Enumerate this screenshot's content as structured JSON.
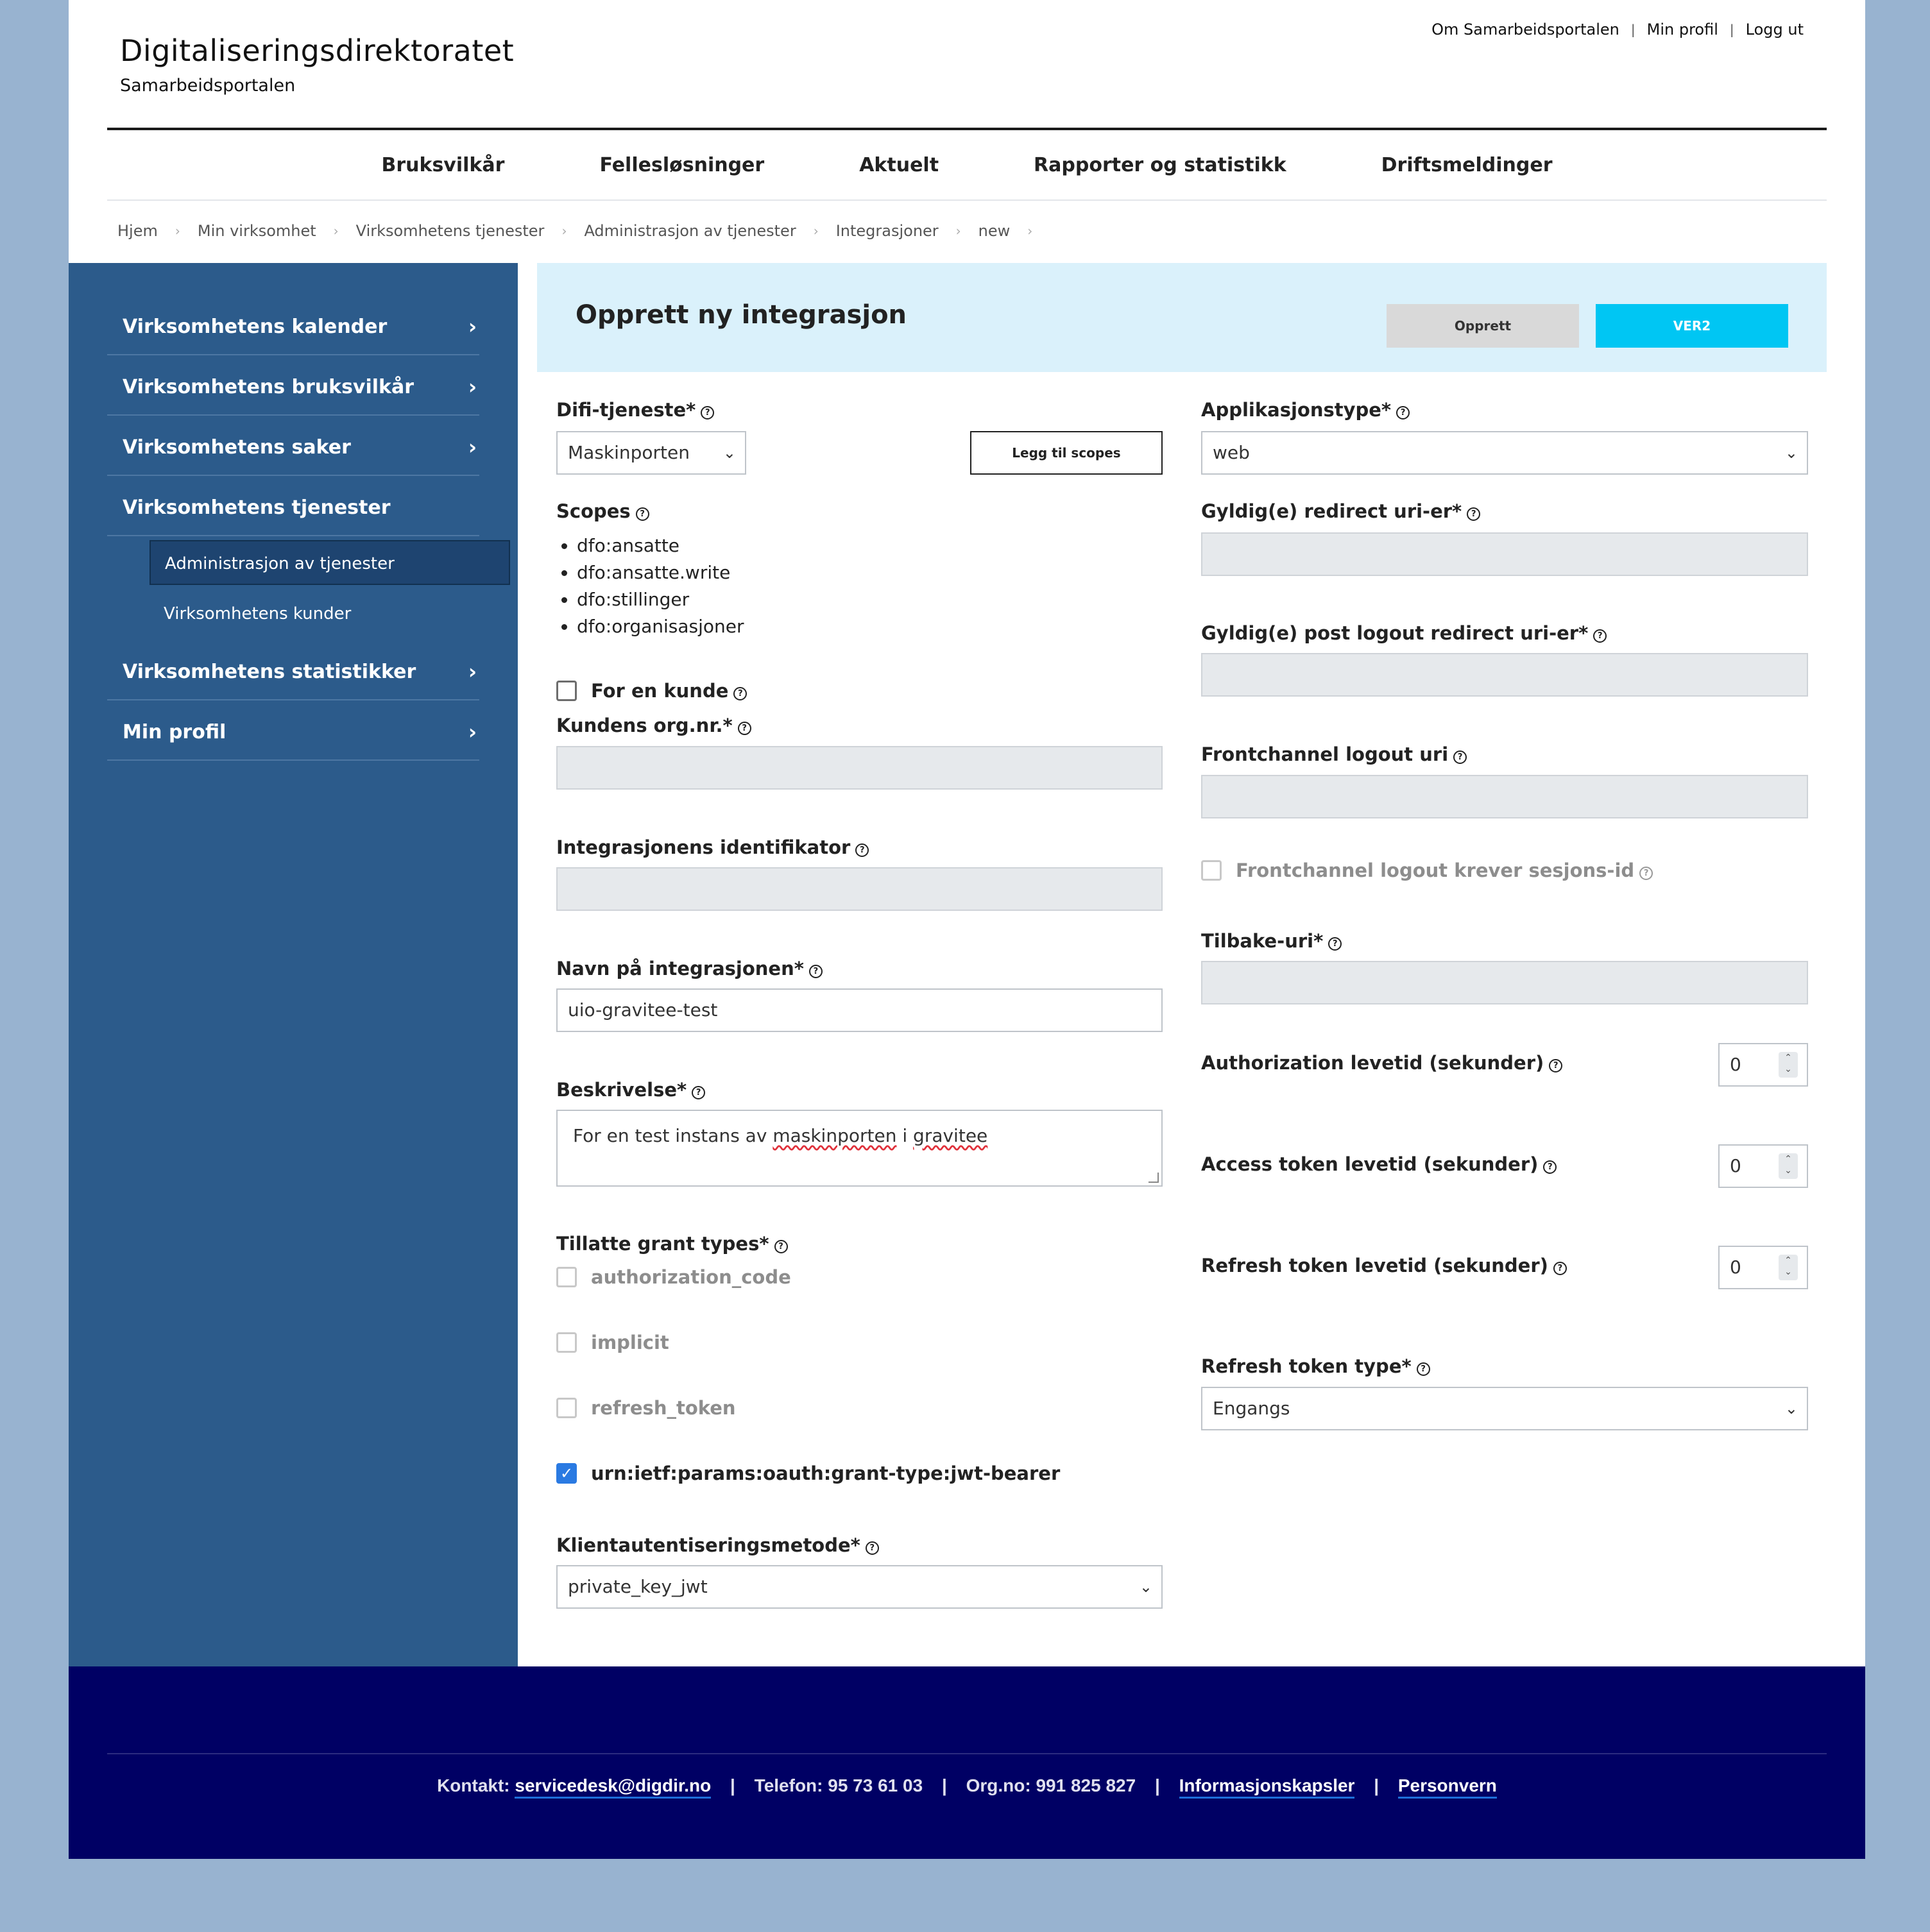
{
  "header": {
    "brand_title": "Digitaliseringsdirektoratet",
    "brand_sub": "Samarbeidsportalen",
    "top_links": [
      "Om Samarbeidsportalen",
      "Min profil",
      "Logg ut"
    ],
    "link_separator": "|"
  },
  "main_nav": [
    "Bruksvilkår",
    "Fellesløsninger",
    "Aktuelt",
    "Rapporter og statistikk",
    "Driftsmeldinger"
  ],
  "breadcrumb": [
    "Hjem",
    "Min virksomhet",
    "Virksomhetens tjenester",
    "Administrasjon av tjenester",
    "Integrasjoner",
    "new"
  ],
  "breadcrumb_sep": "›",
  "sidebar": {
    "items": [
      {
        "label": "Virksomhetens kalender",
        "arrow": "›"
      },
      {
        "label": "Virksomhetens bruksvilkår",
        "arrow": "›"
      },
      {
        "label": "Virksomhetens saker",
        "arrow": "›"
      },
      {
        "label": "Virksomhetens tjenester",
        "arrow": ""
      },
      {
        "label": "Virksomhetens statistikker",
        "arrow": "›"
      },
      {
        "label": "Min profil",
        "arrow": "›"
      }
    ],
    "sub_items": [
      "Administrasjon av tjenester",
      "Virksomhetens kunder"
    ]
  },
  "panel": {
    "title": "Opprett ny integrasjon",
    "btn_opprett": "Opprett",
    "btn_ver2": "VER2"
  },
  "form_left": {
    "difi_label": "Difi-tjeneste*",
    "difi_value": "Maskinporten",
    "add_scopes_button": "Legg til scopes",
    "scopes_label": "Scopes",
    "scopes": [
      "dfo:ansatte",
      "dfo:ansatte.write",
      "dfo:stillinger",
      "dfo:organisasjoner"
    ],
    "for_kunde_label": "For en kunde",
    "kunde_org_label": "Kundens org.nr.*",
    "kunde_org_value": "",
    "identifikator_label": "Integrasjonens identifikator",
    "identifikator_value": "",
    "navn_label": "Navn på integrasjonen*",
    "navn_value": "uio-gravitee-test",
    "beskrivelse_label": "Beskrivelse*",
    "beskrivelse_parts": [
      "For en test instans av ",
      "maskinporten",
      " i ",
      "gravitee"
    ],
    "grant_types_label": "Tillatte grant types*",
    "grant_types": [
      {
        "label": "authorization_code",
        "checked": false,
        "enabled": false
      },
      {
        "label": "implicit",
        "checked": false,
        "enabled": false
      },
      {
        "label": "refresh_token",
        "checked": false,
        "enabled": false
      },
      {
        "label": "urn:ietf:params:oauth:grant-type:jwt-bearer",
        "checked": true,
        "enabled": true
      }
    ],
    "klient_label": "Klientautentiseringsmetode*",
    "klient_value": "private_key_jwt"
  },
  "form_right": {
    "apptype_label": "Applikasjonstype*",
    "apptype_value": "web",
    "redirect_label": "Gyldig(e) redirect uri-er*",
    "post_logout_label": "Gyldig(e) post logout redirect uri-er*",
    "frontchannel_label": "Frontchannel logout uri",
    "frontchannel_sesjon_label": "Frontchannel logout krever sesjons-id",
    "tilbake_label": "Tilbake-uri*",
    "auth_levetid_label": "Authorization levetid (sekunder)",
    "auth_levetid_value": "0",
    "access_levetid_label": "Access token levetid (sekunder)",
    "access_levetid_value": "0",
    "refresh_levetid_label": "Refresh token levetid (sekunder)",
    "refresh_levetid_value": "0",
    "refresh_type_label": "Refresh token type*",
    "refresh_type_value": "Engangs"
  },
  "footer": {
    "kontakt_label": "Kontakt:",
    "kontakt_email": "servicedesk@digdir.no",
    "telefon": "Telefon: 95 73 61 03",
    "orgno": "Org.no: 991 825 827",
    "informasjonskapsler": "Informasjonskapsler",
    "personvern": "Personvern",
    "separator": "|"
  },
  "colors": {
    "page_bg": "#98b3d0",
    "sidebar_bg": "#2c5b8b",
    "panel_head_bg": "#daf1fb",
    "ver2_button": "#00c6f3",
    "checkbox_checked": "#2a7ae2",
    "footer_bg": "#000064"
  },
  "icons": {
    "help": "question-circle-icon",
    "dropdown": "chevron-down-icon",
    "spinner": "up-down-spinner-icon",
    "sidebar_arrow": "chevron-right-icon",
    "checkmark": "check-icon"
  }
}
